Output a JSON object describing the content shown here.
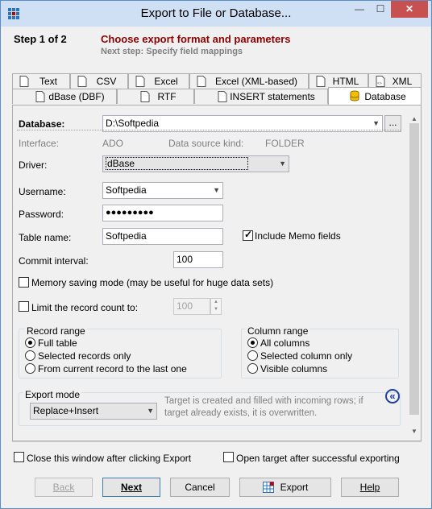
{
  "window": {
    "title": "Export to File or Database...",
    "controls": {
      "minimize": "—",
      "maximize": "☐",
      "close": "✕"
    }
  },
  "header": {
    "step": "Step 1 of 2",
    "title": "Choose export format and parameters",
    "next": "Next step: Specify field mappings"
  },
  "tabs_row1": [
    {
      "label": "Text",
      "icon": "document-icon"
    },
    {
      "label": "CSV",
      "icon": "document-icon"
    },
    {
      "label": "Excel",
      "icon": "document-icon"
    },
    {
      "label": "Excel (XML-based)",
      "icon": "document-icon"
    },
    {
      "label": "HTML",
      "icon": "document-icon"
    },
    {
      "label": "XML",
      "icon": "xml-document-icon"
    }
  ],
  "tabs_row2": [
    {
      "label": "dBase (DBF)",
      "icon": "document-icon"
    },
    {
      "label": "RTF",
      "icon": "document-icon"
    },
    {
      "label": "INSERT statements",
      "icon": "document-icon"
    },
    {
      "label": "Database",
      "icon": "database-icon",
      "active": true
    }
  ],
  "form": {
    "database_label": "Database:",
    "database_value": "D:\\Softpedia",
    "browse_label": "...",
    "interface_label": "Interface:",
    "interface_value": "ADO",
    "source_kind_label": "Data source kind:",
    "source_kind_value": "FOLDER",
    "driver_label": "Driver:",
    "driver_value": "dBase",
    "username_label": "Username:",
    "username_value": "Softpedia",
    "password_label": "Password:",
    "password_value": "●●●●●●●●●",
    "table_label": "Table name:",
    "table_value": "Softpedia",
    "include_memo_label": "Include Memo fields",
    "include_memo_checked": true,
    "commit_label": "Commit interval:",
    "commit_value": "100",
    "memory_saving_label": "Memory saving mode (may be useful for huge data sets)",
    "memory_saving_checked": false,
    "limit_label": "Limit the record count to:",
    "limit_checked": false,
    "limit_value": "100"
  },
  "record_range": {
    "title": "Record range",
    "options": [
      {
        "label": "Full table",
        "checked": true
      },
      {
        "label": "Selected records only",
        "checked": false
      },
      {
        "label": "From current record to the last one",
        "checked": false
      }
    ]
  },
  "column_range": {
    "title": "Column range",
    "options": [
      {
        "label": "All columns",
        "checked": true
      },
      {
        "label": "Selected column only",
        "checked": false
      },
      {
        "label": "Visible columns",
        "checked": false
      }
    ]
  },
  "export_mode": {
    "title": "Export mode",
    "value": "Replace+Insert",
    "description": "Target is created and filled with incoming rows; if target already exists, it is overwritten.",
    "collapse_glyph": "«"
  },
  "bottom": {
    "close_after_label": "Close this window after clicking Export",
    "close_after_checked": false,
    "open_target_label": "Open target after successful exporting",
    "open_target_checked": false
  },
  "buttons": {
    "back": "Back",
    "next": "Next",
    "cancel": "Cancel",
    "export": "Export",
    "help": "Help"
  }
}
